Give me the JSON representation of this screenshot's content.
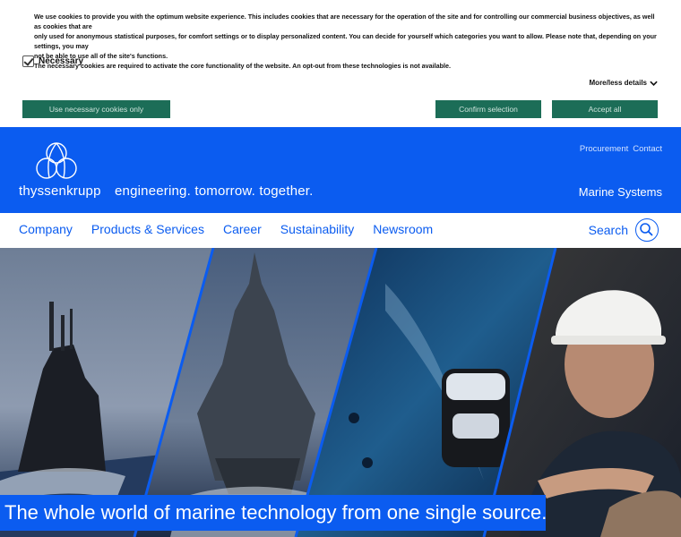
{
  "cookie": {
    "text_lines": [
      "We use cookies to provide you with the optimum website experience. This includes cookies that are necessary for the operation of the site and for controlling our commercial business objectives, as well as cookies that are",
      "only used for anonymous statistical purposes, for comfort settings or to display personalized content. You can decide for yourself which categories you want to allow. Please note that, depending on your settings, you may",
      "not be able to use all of the site's functions.",
      "The necessary cookies are required to activate the core functionality of the website. An opt-out from these technologies is not available."
    ],
    "necessary_label": "Necessary",
    "more_label": "More/less details",
    "btn_necessary": "Use necessary cookies only",
    "btn_confirm": "Confirm selection",
    "btn_accept": "Accept all"
  },
  "header": {
    "brand": "thyssenkrupp",
    "tagline": "engineering. tomorrow. together.",
    "links": [
      "Procurement",
      "Contact"
    ],
    "division": "Marine Systems"
  },
  "nav": {
    "items": [
      "Company",
      "Products & Services",
      "Career",
      "Sustainability",
      "Newsroom"
    ],
    "search_label": "Search"
  },
  "hero": {
    "caption": "The whole world of marine technology from one single source."
  },
  "colors": {
    "brand_blue": "#0b5cf0",
    "cookie_button": "#1c6d57"
  }
}
